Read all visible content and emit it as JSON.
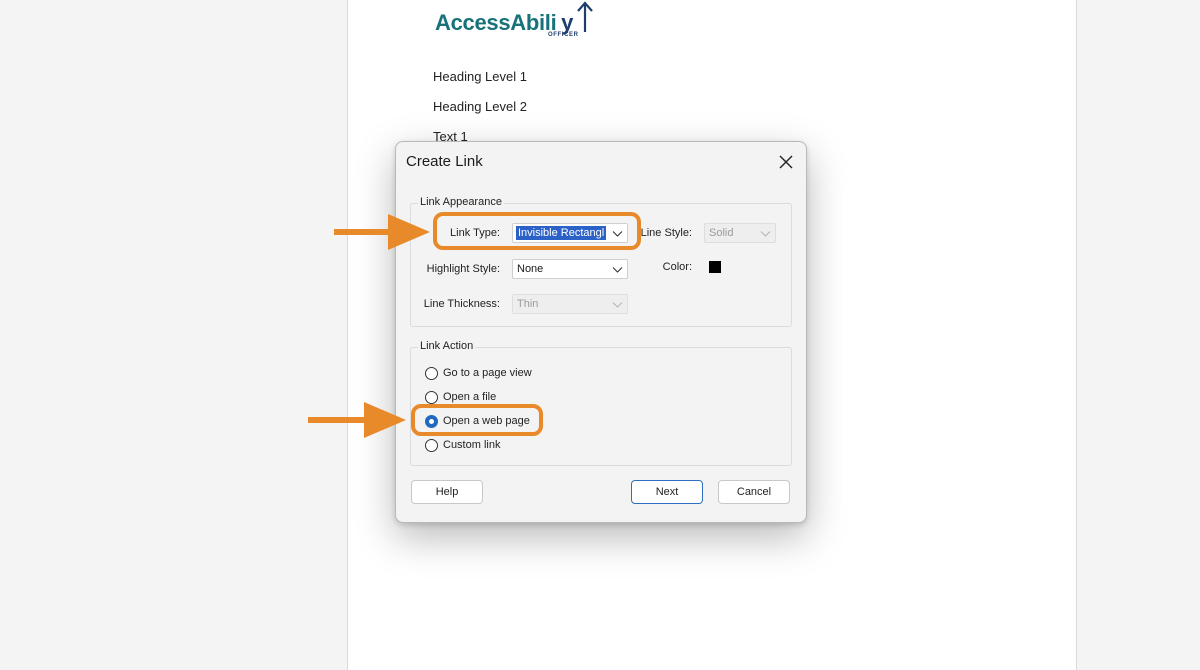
{
  "document": {
    "logo": {
      "text_main": "AccessAbili",
      "text_tail": "y",
      "subtitle": "OFFICER"
    },
    "lines": [
      "Heading Level 1",
      "Heading Level 2",
      "Text 1"
    ]
  },
  "dialog": {
    "title": "Create Link",
    "appearance": {
      "group_label": "Link Appearance",
      "link_type": {
        "label": "Link Type:",
        "value": "Invisible Rectangl"
      },
      "line_style": {
        "label": "Line Style:",
        "value": "Solid"
      },
      "highlight_style": {
        "label": "Highlight Style:",
        "value": "None"
      },
      "color": {
        "label": "Color:",
        "value": "#000000"
      },
      "line_thickness": {
        "label": "Line Thickness:",
        "value": "Thin"
      }
    },
    "action": {
      "group_label": "Link Action",
      "options": [
        {
          "label": "Go to a page view",
          "checked": false
        },
        {
          "label": "Open a file",
          "checked": false
        },
        {
          "label": "Open a web page",
          "checked": true
        },
        {
          "label": "Custom link",
          "checked": false
        }
      ]
    },
    "buttons": {
      "help": "Help",
      "next": "Next",
      "cancel": "Cancel"
    }
  },
  "colors": {
    "callout": "#e98a2a",
    "accent": "#2069c0",
    "brand_teal": "#17727a",
    "brand_navy": "#1f3d6e"
  }
}
